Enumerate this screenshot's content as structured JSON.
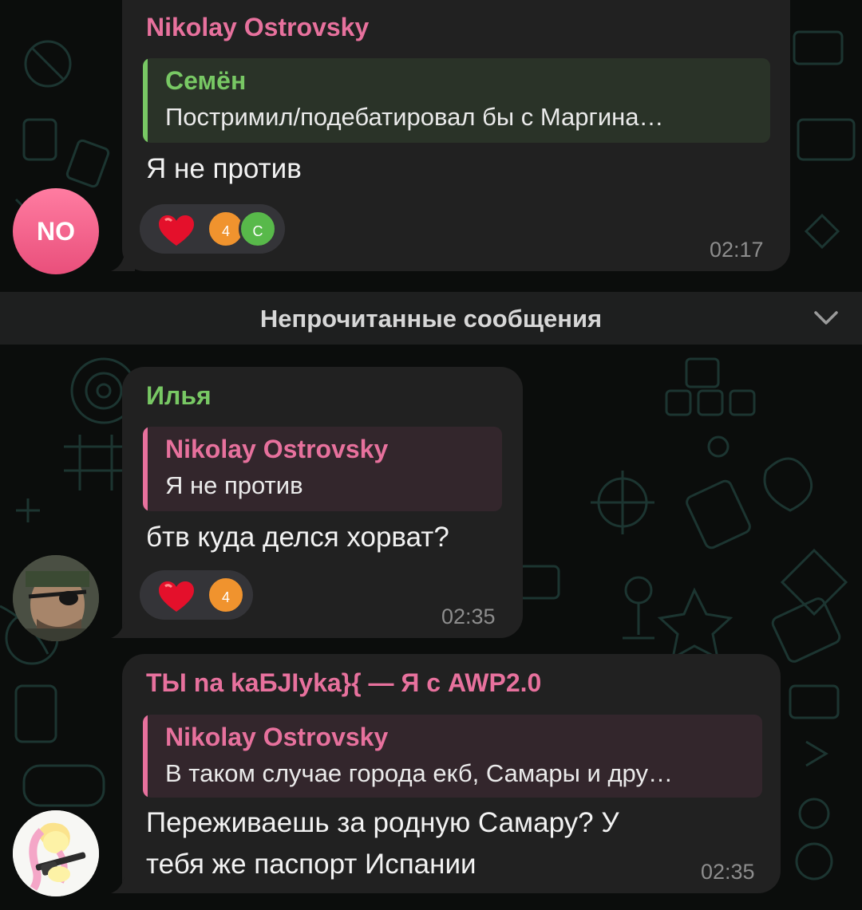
{
  "colors": {
    "pink_name": "#e7719d",
    "green_name": "#78c864",
    "bubble": "#212121",
    "time": "#8d8d8d"
  },
  "messages": [
    {
      "sender": "Nikolay Ostrovsky",
      "reply_to": {
        "name": "Семён",
        "text": "Постримил/подебатировал бы с Маргина…"
      },
      "text": "Я не против",
      "reactions": {
        "emoji": "heart",
        "avatars": [
          "4",
          "С"
        ]
      },
      "time": "02:17",
      "avatar": {
        "initials": "NO",
        "kind": "initials"
      }
    },
    {
      "sender": "Илья",
      "reply_to": {
        "name": "Nikolay Ostrovsky",
        "text": "Я не против"
      },
      "text": "бтв куда делся хорват?",
      "reactions": {
        "emoji": "heart",
        "avatars": [
          "4"
        ]
      },
      "time": "02:35",
      "avatar": {
        "kind": "photo",
        "icon": "eyepatch-soldier-avatar"
      }
    },
    {
      "sender": "ТЫ na kaБJIyka}{ — Я с AWP2.0",
      "reply_to": {
        "name": "Nikolay Ostrovsky",
        "text": "В таком случае города екб, Самары и дру…"
      },
      "text_lines": [
        "Переживаешь за родную Самару? У",
        "тебя же паспорт Испании"
      ],
      "time": "02:35",
      "avatar": {
        "kind": "photo",
        "icon": "pony-avatar"
      }
    }
  ],
  "unread_divider": {
    "label": "Непрочитанные сообщения",
    "icon": "chevron-down-icon"
  }
}
